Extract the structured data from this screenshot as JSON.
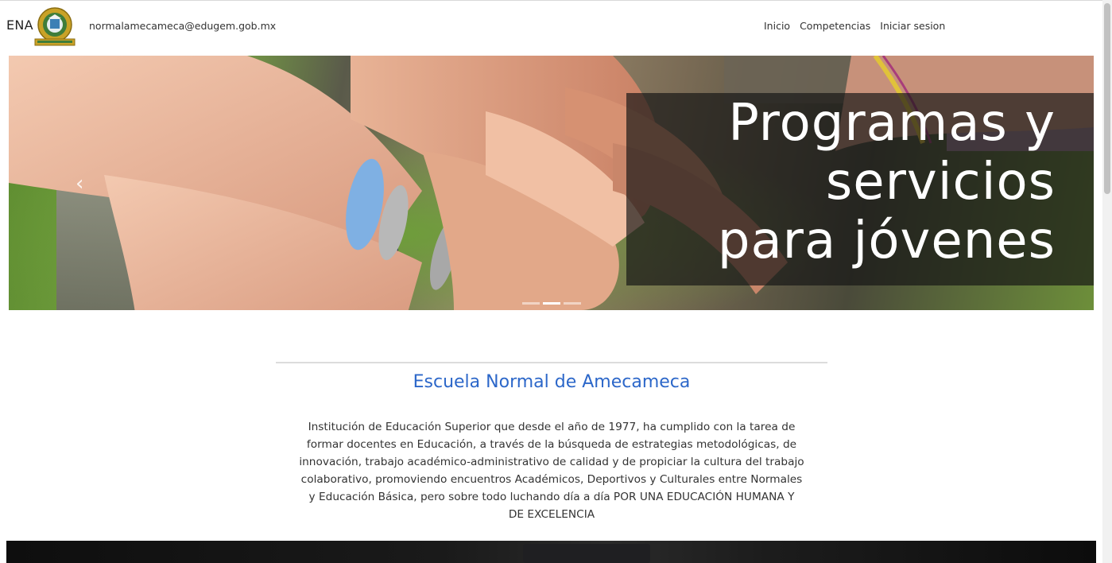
{
  "header": {
    "brand": "ENA",
    "email": "normalamecameca@edugem.gob.mx",
    "nav": [
      "Inicio",
      "Competencias",
      "Iniciar sesion"
    ]
  },
  "carousel": {
    "caption_lines": [
      "Programas y",
      "servicios",
      "para jóvenes"
    ],
    "prev_icon": "chevron-left-icon",
    "active_slide": 2,
    "slide_count": 3
  },
  "content": {
    "title": "Escuela Normal de Amecameca",
    "description_lines": [
      "Institución de Educación Superior que desde el año de 1977, ha cumplido con la tarea de",
      "formar docentes en Educación, a través de la búsqueda de estrategias metodológicas, de",
      "innovación, trabajo académico-administrativo de calidad y de propiciar la cultura del trabajo",
      "colaborativo, promoviendo encuentros Académicos, Deportivos y Culturales entre Normales",
      "y Educación Básica, pero sobre todo luchando día a día POR UNA EDUCACIÓN HUMANA Y",
      "DE EXCELENCIA"
    ]
  },
  "colors": {
    "title_blue": "#2c67c9",
    "logo_gold": "#c9a227",
    "logo_green": "#3f7d3a"
  }
}
